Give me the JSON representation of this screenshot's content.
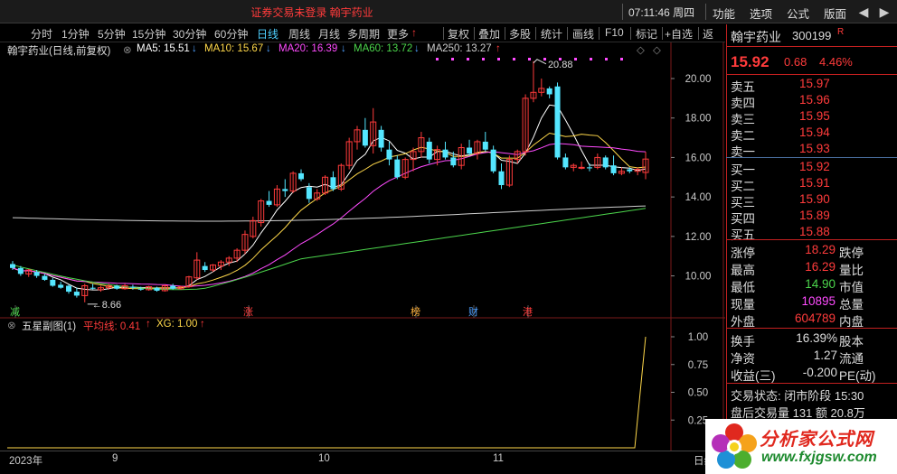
{
  "window": {
    "title": "证券交易未登录   翰宇药业",
    "time": "07:11:46 周四",
    "menu": [
      "功能",
      "选项",
      "公式",
      "版面"
    ],
    "nav_back": "◀",
    "nav_forward": "▶"
  },
  "toolbar": {
    "periods": [
      "分时",
      "1分钟",
      "5分钟",
      "15分钟",
      "30分钟",
      "60分钟",
      "日线",
      "周线",
      "月线",
      "多周期",
      "更多"
    ],
    "active_period": "日线",
    "more_arrow": "↑",
    "actions": [
      "复权",
      "叠加",
      "多股",
      "统计",
      "画线",
      "F10",
      "标记",
      "+自选",
      "返"
    ]
  },
  "main_chart": {
    "header": "翰宇药业(日线,前复权)",
    "ma": [
      {
        "label": "MA5: 15.51",
        "arrow": "↓",
        "color": "#ffffff"
      },
      {
        "label": "MA10: 15.67",
        "arrow": "↓",
        "color": "#ffd84a"
      },
      {
        "label": "MA20: 16.39",
        "arrow": "↓",
        "color": "#ff4bff"
      },
      {
        "label": "MA60: 13.72",
        "arrow": "↓",
        "color": "#4cd64c"
      },
      {
        "label": "MA250: 13.27",
        "arrow": "↑",
        "color": "#cfcfcf"
      }
    ],
    "price_ticks": [
      "20.00",
      "18.00",
      "16.00",
      "14.00",
      "12.00",
      "10.00"
    ],
    "high_label": "20.88",
    "low_label": "8.66",
    "events": [
      {
        "text": "减",
        "color": "#4cd64c"
      },
      {
        "text": "涨",
        "color": "#ff3b3b"
      },
      {
        "text": "榜",
        "color": "#ffb13b"
      },
      {
        "text": "财",
        "color": "#4fa0ff"
      },
      {
        "text": "港",
        "color": "#ff3b3b"
      }
    ]
  },
  "sub_chart": {
    "name": "五星副图(1)",
    "avg_label": "平均线: 0.41",
    "avg_arrow": "↑",
    "xg_label": "XG: 1.00",
    "xg_arrow": "↑",
    "ticks": [
      "1.00",
      "0.75",
      "0.50",
      "0.25"
    ]
  },
  "x_axis": {
    "labels": [
      "2023年",
      "9",
      "10",
      "11"
    ]
  },
  "quote": {
    "name": "翰宇药业",
    "code": "300199",
    "tag": "R",
    "price": "15.92",
    "change": "0.68",
    "pct": "4.46%",
    "sells": [
      {
        "label": "卖五",
        "price": "15.97"
      },
      {
        "label": "卖四",
        "price": "15.96"
      },
      {
        "label": "卖三",
        "price": "15.95"
      },
      {
        "label": "卖二",
        "price": "15.94"
      },
      {
        "label": "卖一",
        "price": "15.93"
      }
    ],
    "buys": [
      {
        "label": "买一",
        "price": "15.92"
      },
      {
        "label": "买二",
        "price": "15.91"
      },
      {
        "label": "买三",
        "price": "15.90"
      },
      {
        "label": "买四",
        "price": "15.89"
      },
      {
        "label": "买五",
        "price": "15.88"
      }
    ],
    "stats": [
      {
        "label": "涨停",
        "value": "18.29",
        "color": "#ff3b3b",
        "label2": "跌停"
      },
      {
        "label": "最高",
        "value": "16.29",
        "color": "#ff3b3b",
        "label2": "量比"
      },
      {
        "label": "最低",
        "value": "14.90",
        "color": "#4cd64c",
        "label2": "市值"
      },
      {
        "label": "现量",
        "value": "10895",
        "color": "#ff4bff",
        "label2": "总量"
      },
      {
        "label": "外盘",
        "value": "604789",
        "color": "#ff3b3b",
        "label2": "内盘"
      }
    ],
    "stats2": [
      {
        "label": "换手",
        "value": "16.39%",
        "label2": "股本"
      },
      {
        "label": "净资",
        "value": "1.27",
        "label2": "流通"
      },
      {
        "label": "收益(三)",
        "value": "-0.200",
        "label2": "PE(动)"
      }
    ],
    "trade_status": "交易状态: 闭市阶段 15:30",
    "after_trade": "盘后交易量 131 额 20.8万"
  },
  "watermark": {
    "text": "分析家公式网",
    "url": "www.fxjgsw.com"
  },
  "axis_fragment": "日线"
}
